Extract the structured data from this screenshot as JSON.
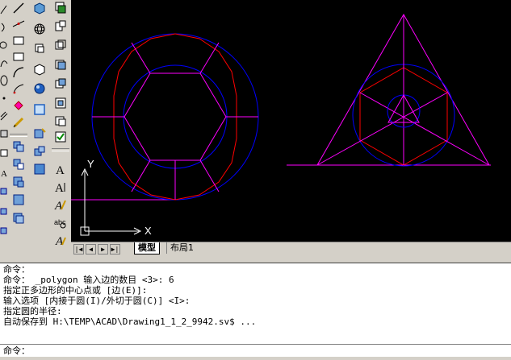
{
  "tabs": {
    "model": "模型",
    "layout1": "布局1"
  },
  "nav_buttons": [
    "|◀",
    "◀",
    "▶",
    "▶|"
  ],
  "ucs": {
    "y_label": "Y",
    "x_label": "X"
  },
  "command_history": [
    "命令：",
    "命令： _polygon 输入边的数目 <3>: 6",
    "指定正多边形的中心点或 [边(E)]:",
    "输入选项 [内接于圆(I)/外切于圆(C)] <I>:",
    "指定圆的半径:",
    "自动保存到 H:\\TEMP\\ACAD\\Drawing1_1_2_9942.sv$ ..."
  ],
  "command_prompt": "命令：",
  "colors": {
    "canvas": "#000000",
    "circle": "#0000ff",
    "polygon": "#ff0000",
    "construction": "#ff00ff",
    "ucs": "#ffffff"
  },
  "toolbar_icons": {
    "draw": [
      "line-icon",
      "construction-line-icon",
      "polyline-icon",
      "polygon-icon",
      "rectangle-icon",
      "arc-icon",
      "circle-icon",
      "revision-cloud-icon",
      "spline-icon",
      "ellipse-icon",
      "ellipse-arc-icon",
      "insert-block-icon",
      "make-block-icon",
      "point-icon",
      "hatch-icon",
      "region-icon"
    ],
    "modify": [
      "erase-icon",
      "copy-icon",
      "mirror-icon",
      "offset-icon",
      "array-icon",
      "move-icon",
      "rotate-icon",
      "scale-icon",
      "stretch-icon",
      "trim-icon",
      "extend-icon",
      "break-icon",
      "join-icon",
      "chamfer-icon",
      "fillet-icon",
      "explode-icon"
    ],
    "solids": [
      "box-icon",
      "sphere-icon",
      "cylinder-icon",
      "cone-icon",
      "wedge-icon",
      "torus-icon",
      "extrude-icon",
      "revolve-icon",
      "section-icon",
      "slice-icon"
    ],
    "text": [
      "multiline-text-icon",
      "single-line-text-icon",
      "edit-text-icon",
      "find-replace-icon",
      "spell-check-icon",
      "text-style-icon",
      "scale-text-icon",
      "justify-text-icon"
    ]
  }
}
